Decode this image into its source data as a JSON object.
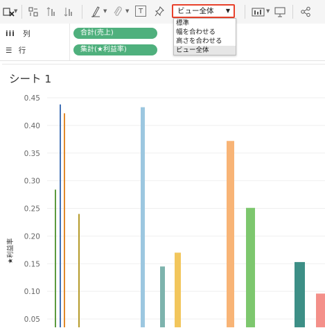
{
  "toolbar": {
    "view_select": {
      "value": "ビュー全体"
    },
    "view_options": [
      "標準",
      "幅を合わせる",
      "高さを合わせる",
      "ビュー全体"
    ],
    "text_icon_glyph": "T",
    "icons": [
      "swap-icon",
      "group-icon",
      "sort-ascending-icon",
      "sort-descending-icon",
      "highlight-pen-icon",
      "annotate-paperclip-icon",
      "text-icon",
      "pin-icon",
      "show-me-icon",
      "presentation-icon",
      "share-icon"
    ]
  },
  "shelves": {
    "columns": {
      "label": "列",
      "pill": "合計(売上)"
    },
    "rows": {
      "label": "行",
      "pill": "集計(★利益率)"
    }
  },
  "sheet": {
    "title": "シート 1"
  },
  "chart_data": {
    "type": "bar",
    "ylabel": "★利益率",
    "yticks": [
      "0.45",
      "0.40",
      "0.35",
      "0.30",
      "0.25",
      "0.20",
      "0.15",
      "0.10",
      "0.05"
    ],
    "ylim_visible": [
      0.03,
      0.47
    ],
    "grid": true,
    "series_values": [
      0.284,
      0.438,
      0.422,
      0.24,
      0.433,
      0.145,
      0.17,
      0.372,
      0.251,
      0.153,
      0.096
    ],
    "colors": [
      "#5b9a3e",
      "#3f6fb5",
      "#e0892b",
      "#b59a2a",
      "#9cc7e0",
      "#7db3ad",
      "#f2c65c",
      "#f8b476",
      "#7dc76e",
      "#3d8f86",
      "#f4908a"
    ]
  }
}
